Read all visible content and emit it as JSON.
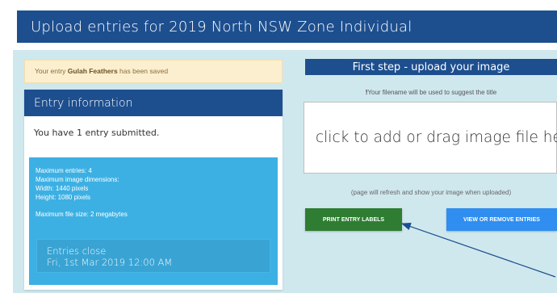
{
  "header": {
    "title": "Upload entries for 2019 North NSW Zone Individual"
  },
  "alert": {
    "prefix": "Your entry ",
    "entry_name": "Gulah Feathers",
    "suffix": " has been saved"
  },
  "entry_panel": {
    "title": "Entry information",
    "summary": "You have 1 entry submitted.",
    "max_entries": "Maximum entries: 4",
    "max_dimensions": "Maximum image dimensions:",
    "width": "Width: 1440 pixels",
    "height": "Height: 1080 pixels",
    "max_file_size": "Maximum file size: 2 megabytes",
    "closes_label": "Entries close",
    "closes_date": "Fri, 1st Mar 2019 12:00 AM"
  },
  "upload": {
    "title": "First step - upload your image",
    "filename_note_mark": "!",
    "filename_note": "Your filename will be used to suggest the title",
    "dropzone_text": "click to add or drag image file here",
    "refresh_note": "(page will refresh and show your image when uploaded)"
  },
  "buttons": {
    "print_labels": "PRINT ENTRY LABELS",
    "view_remove": "VIEW OR REMOVE ENTRIES"
  },
  "colors": {
    "primary": "#1d4f8f",
    "info": "#3db0e3",
    "success": "#2e7d32",
    "button_blue": "#2f8ef0",
    "background": "#cfe8ee"
  }
}
